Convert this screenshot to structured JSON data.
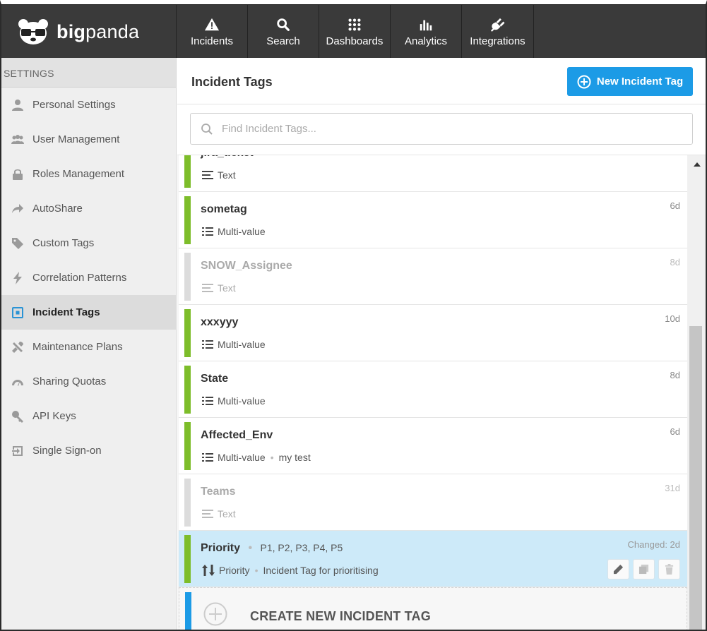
{
  "app": {
    "logo_text_bold": "big",
    "logo_text": "panda"
  },
  "nav": {
    "tabs": [
      {
        "label": "Incidents",
        "icon": "warning-icon"
      },
      {
        "label": "Search",
        "icon": "search-icon"
      },
      {
        "label": "Dashboards",
        "icon": "grid-icon"
      },
      {
        "label": "Analytics",
        "icon": "bar-chart-icon"
      },
      {
        "label": "Integrations",
        "icon": "plug-icon"
      }
    ]
  },
  "sidebar": {
    "header": "SETTINGS",
    "items": [
      {
        "label": "Personal Settings",
        "icon": "user-icon"
      },
      {
        "label": "User Management",
        "icon": "users-icon"
      },
      {
        "label": "Roles Management",
        "icon": "lock-icon"
      },
      {
        "label": "AutoShare",
        "icon": "share-icon"
      },
      {
        "label": "Custom Tags",
        "icon": "tag-icon"
      },
      {
        "label": "Correlation Patterns",
        "icon": "bolt-icon"
      },
      {
        "label": "Incident Tags",
        "icon": "target-icon",
        "active": true
      },
      {
        "label": "Maintenance Plans",
        "icon": "tools-icon"
      },
      {
        "label": "Sharing Quotas",
        "icon": "gauge-icon"
      },
      {
        "label": "API Keys",
        "icon": "key-icon"
      },
      {
        "label": "Single Sign-on",
        "icon": "signin-icon"
      }
    ]
  },
  "main": {
    "title": "Incident Tags",
    "new_button": "New Incident Tag",
    "search_placeholder": "Find Incident Tags...",
    "tags": [
      {
        "name": "jira_ticket",
        "type": "Text",
        "age": "",
        "active": true
      },
      {
        "name": "sometag",
        "type": "Multi-value",
        "age": "6d",
        "active": true
      },
      {
        "name": "SNOW_Assignee",
        "type": "Text",
        "age": "8d",
        "active": false
      },
      {
        "name": "xxxyyy",
        "type": "Multi-value",
        "age": "10d",
        "active": true
      },
      {
        "name": "State",
        "type": "Multi-value",
        "age": "8d",
        "active": true
      },
      {
        "name": "Affected_Env",
        "type": "Multi-value",
        "description": "my test",
        "age": "6d",
        "active": true
      },
      {
        "name": "Teams",
        "type": "Text",
        "age": "31d",
        "active": false
      }
    ],
    "selected_tag": {
      "name": "Priority",
      "values": "P1, P2, P3, P4, P5",
      "type": "Priority",
      "description": "Incident Tag for prioritising",
      "age": "Changed: 2d"
    },
    "create_label": "CREATE NEW INCIDENT TAG"
  }
}
